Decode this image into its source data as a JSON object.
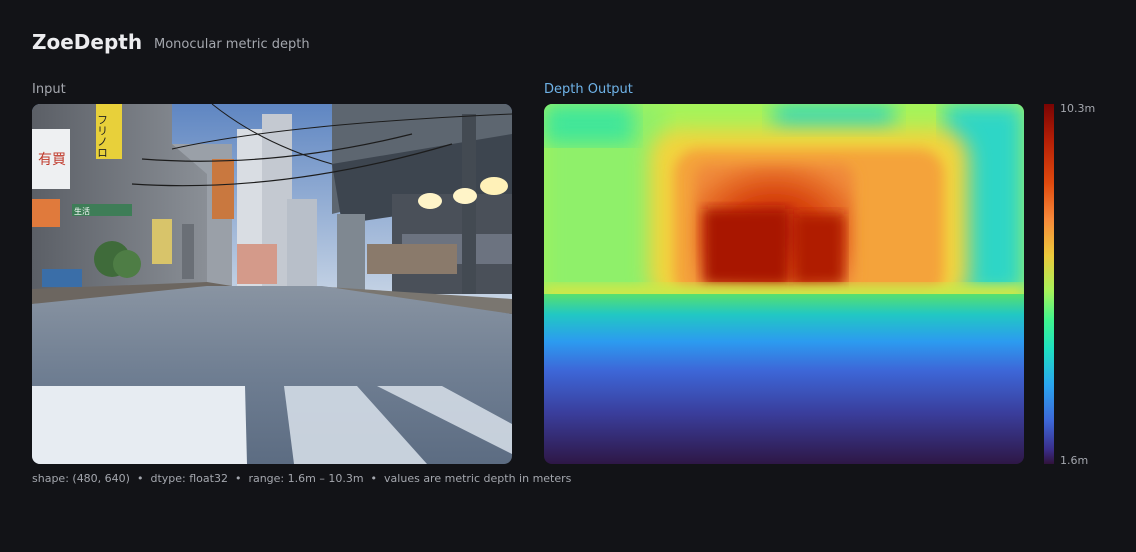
{
  "header": {
    "title": "ZoeDepth",
    "subtitle": "Monocular metric depth"
  },
  "panels": {
    "input_label": "Input",
    "output_label": "Depth Output"
  },
  "scene": {
    "signs": {
      "vertical_sign": "フリノロ",
      "left_sign": "有買",
      "green_sign": "生活"
    }
  },
  "colorbar": {
    "max_label": "10.3m",
    "min_label": "1.6m"
  },
  "footer": {
    "shape": "shape: (480, 640)",
    "dtype": "dtype: float32",
    "range": "range: 1.6m – 10.3m",
    "note": "values are metric depth in meters",
    "separator": "•"
  },
  "colors": {
    "background": "#121317",
    "accent": "#6fb3e8"
  }
}
